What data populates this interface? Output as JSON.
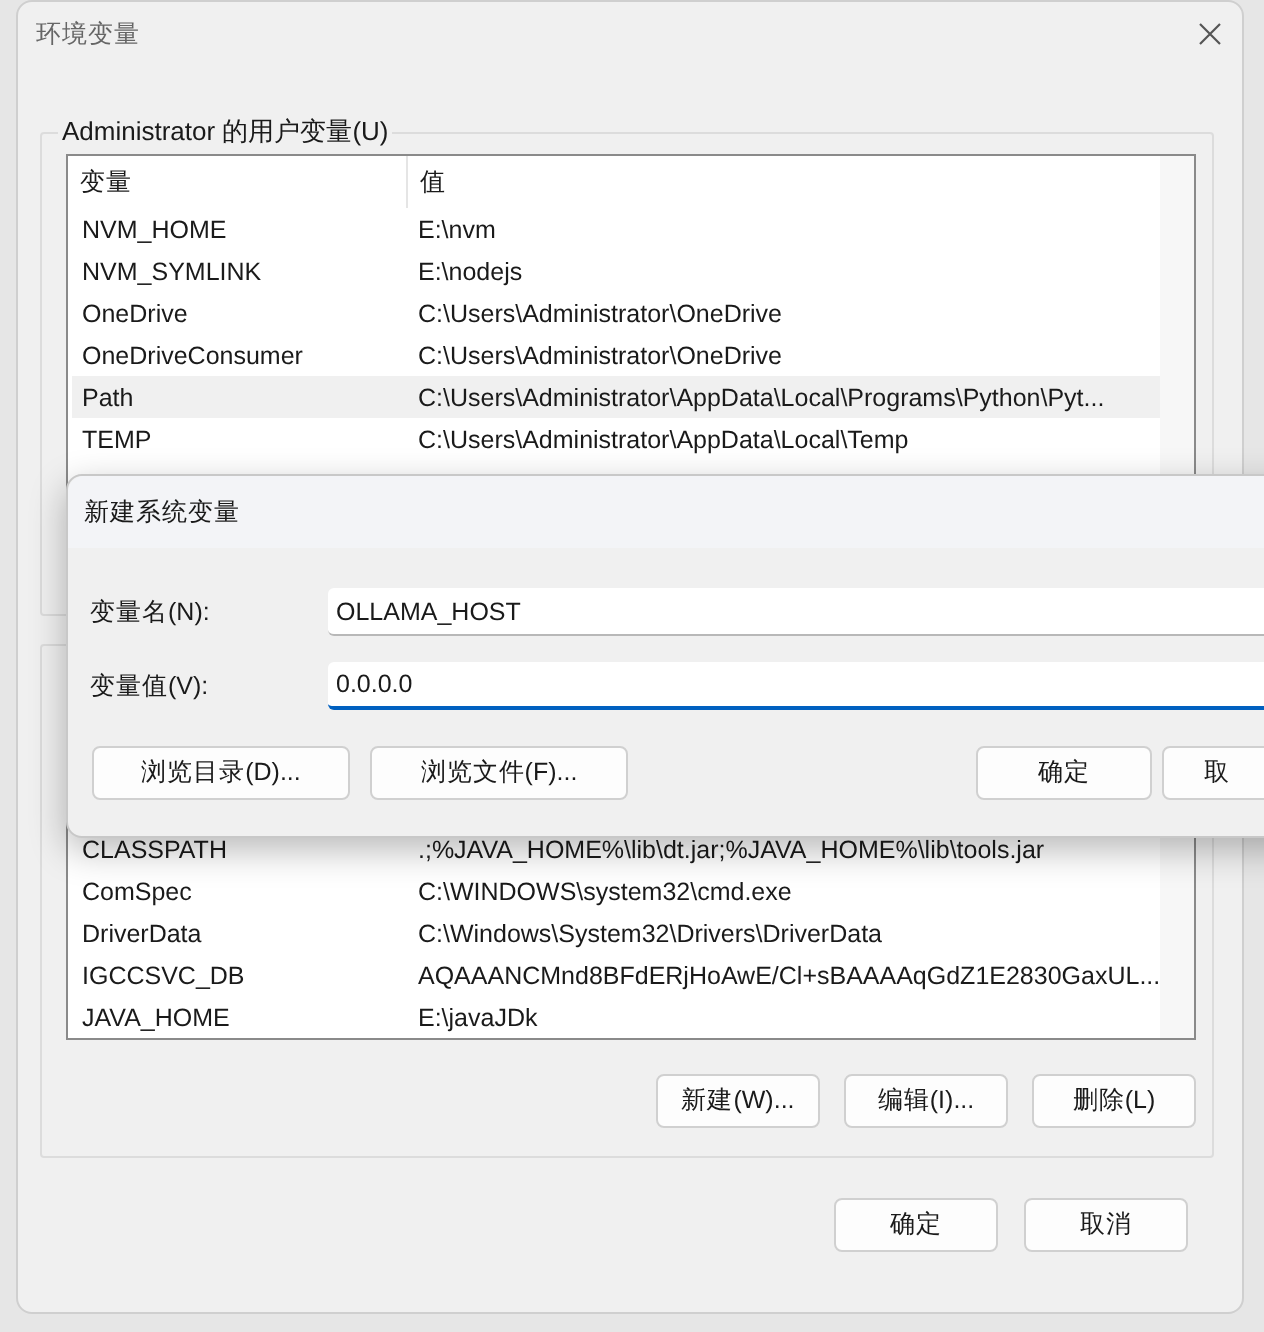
{
  "window": {
    "title": "环境变量"
  },
  "user_variables": {
    "label": "Administrator 的用户变量(U)",
    "columns": [
      "变量",
      "值"
    ],
    "rows": [
      {
        "name": "NVM_HOME",
        "value": "E:\\nvm",
        "selected": false
      },
      {
        "name": "NVM_SYMLINK",
        "value": "E:\\nodejs",
        "selected": false
      },
      {
        "name": "OneDrive",
        "value": "C:\\Users\\Administrator\\OneDrive",
        "selected": false
      },
      {
        "name": "OneDriveConsumer",
        "value": "C:\\Users\\Administrator\\OneDrive",
        "selected": false
      },
      {
        "name": "Path",
        "value": "C:\\Users\\Administrator\\AppData\\Local\\Programs\\Python\\Pyt...",
        "selected": true
      },
      {
        "name": "TEMP",
        "value": "C:\\Users\\Administrator\\AppData\\Local\\Temp",
        "selected": false
      }
    ]
  },
  "system_variables": {
    "rows": [
      {
        "name": "CLASSPATH",
        "value": ".;%JAVA_HOME%\\lib\\dt.jar;%JAVA_HOME%\\lib\\tools.jar",
        "selected": false
      },
      {
        "name": "ComSpec",
        "value": "C:\\WINDOWS\\system32\\cmd.exe",
        "selected": false
      },
      {
        "name": "DriverData",
        "value": "C:\\Windows\\System32\\Drivers\\DriverData",
        "selected": false
      },
      {
        "name": "IGCCSVC_DB",
        "value": "AQAAANCMnd8BFdERjHoAwE/Cl+sBAAAAqGdZ1E2830GaxUL...",
        "selected": false
      },
      {
        "name": "JAVA_HOME",
        "value": "E:\\javaJDk",
        "selected": false
      }
    ],
    "buttons": [
      "新建(W)...",
      "编辑(I)...",
      "删除(L)"
    ]
  },
  "footer_buttons": [
    "确定",
    "取消"
  ],
  "new_variable_dialog": {
    "title": "新建系统变量",
    "fields": [
      {
        "label": "变量名(N):",
        "value": "OLLAMA_HOST",
        "focused": false
      },
      {
        "label": "变量值(V):",
        "value": "0.0.0.0",
        "focused": true
      }
    ],
    "left_buttons": [
      "浏览目录(D)...",
      "浏览文件(F)..."
    ],
    "right_buttons": [
      "确定",
      "取"
    ]
  }
}
